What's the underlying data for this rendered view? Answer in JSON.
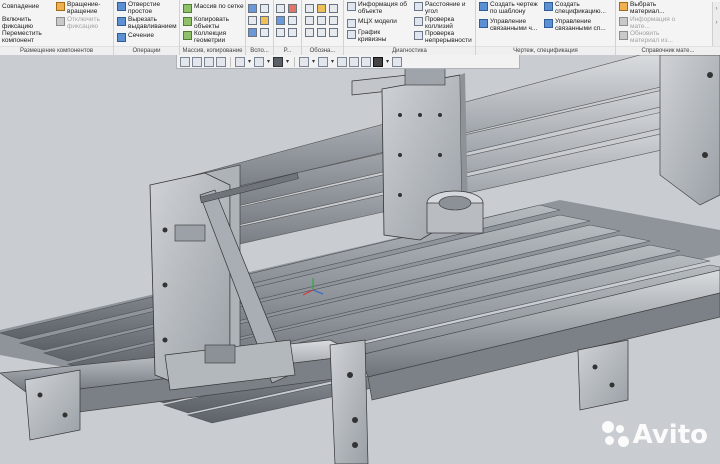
{
  "ribbon": {
    "groups": [
      {
        "caption": "Размещение компонентов",
        "items": [
          "Совпадение",
          "Вращение-вращение",
          "Включить фиксацию",
          "Отключить фиксацию",
          "Переместить компонент"
        ]
      },
      {
        "caption": "Операции",
        "items": [
          "Отверстие простое",
          "Вырезать выдавливанием",
          "Сечение"
        ]
      },
      {
        "caption": "Массив, копирование",
        "items": [
          "Массив по сетке",
          "Копировать объекты",
          "Коллекция геометрии"
        ]
      },
      {
        "caption": "Вспо...",
        "items": []
      },
      {
        "caption": "Р...",
        "items": []
      },
      {
        "caption": "Обозна...",
        "items": []
      },
      {
        "caption": "Диагностика",
        "items": [
          "Информация об объекте",
          "МЦХ модели",
          "График кривизны",
          "Расстояние и угол",
          "Проверка коллизий",
          "Проверка непрерывности"
        ]
      },
      {
        "caption": "Чертеж, спецификация",
        "items": [
          "Создать чертеж по шаблону",
          "Управление связанными ч...",
          "Создать спецификацию...",
          "Управление связанными сп..."
        ]
      },
      {
        "caption": "Справочник мате...",
        "items": [
          "Выбрать материал...",
          "Информация о мате...",
          "Обновить материал из..."
        ]
      }
    ]
  },
  "toolbar": {
    "icons": [
      "zoom-fit-icon",
      "zoom-window-icon",
      "zoom-icon",
      "pan-icon",
      "rotate-icon",
      "orientation-icon",
      "display-style-icon",
      "hide-icon",
      "section-view-icon",
      "filter-icon",
      "gear-icon"
    ]
  },
  "watermark": {
    "text": "Avito"
  },
  "colors": {
    "ribbon": "#f4f4f4",
    "viewport": "#c9ccd0",
    "metal": "#9ea3a9"
  }
}
